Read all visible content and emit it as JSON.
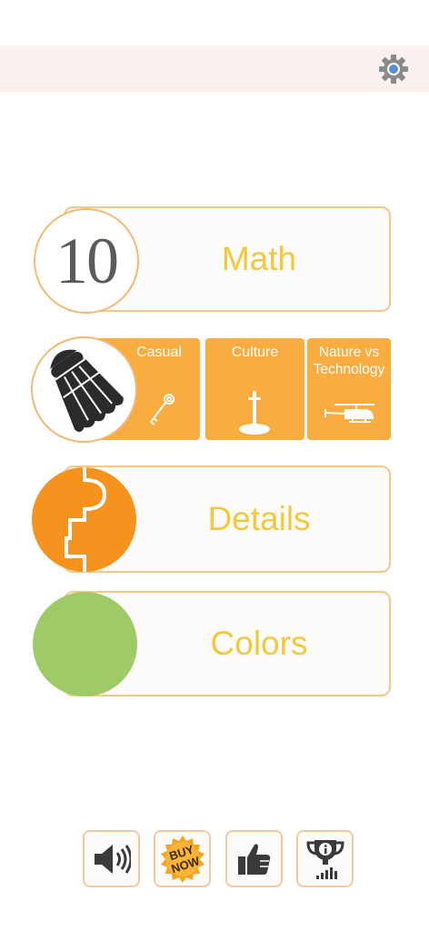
{
  "header": {
    "settings_icon": "gear-icon"
  },
  "math": {
    "number": "10",
    "label": "Math"
  },
  "categories": [
    {
      "label": "Casual",
      "icon": "key-icon"
    },
    {
      "label": "Culture",
      "icon": "sword-in-stone-icon"
    },
    {
      "label": "Nature vs Technology",
      "icon": "helicopter-icon"
    }
  ],
  "category_circle_icon": "shuttlecock-icon",
  "details": {
    "label": "Details",
    "icon": "puzzle-piece-icon"
  },
  "colors": {
    "label": "Colors",
    "circle_color": "#9ecb67"
  },
  "bottom_bar": {
    "buttons": [
      {
        "icon": "speaker-icon"
      },
      {
        "icon": "buy-now-badge-icon",
        "text": "BUY NOW"
      },
      {
        "icon": "thumbs-up-icon"
      },
      {
        "icon": "trophy-info-icon"
      }
    ]
  },
  "theme": {
    "accent_orange": "#f9ad40",
    "label_yellow": "#f3c83c",
    "details_orange": "#f6921e",
    "green": "#9ecb67"
  }
}
